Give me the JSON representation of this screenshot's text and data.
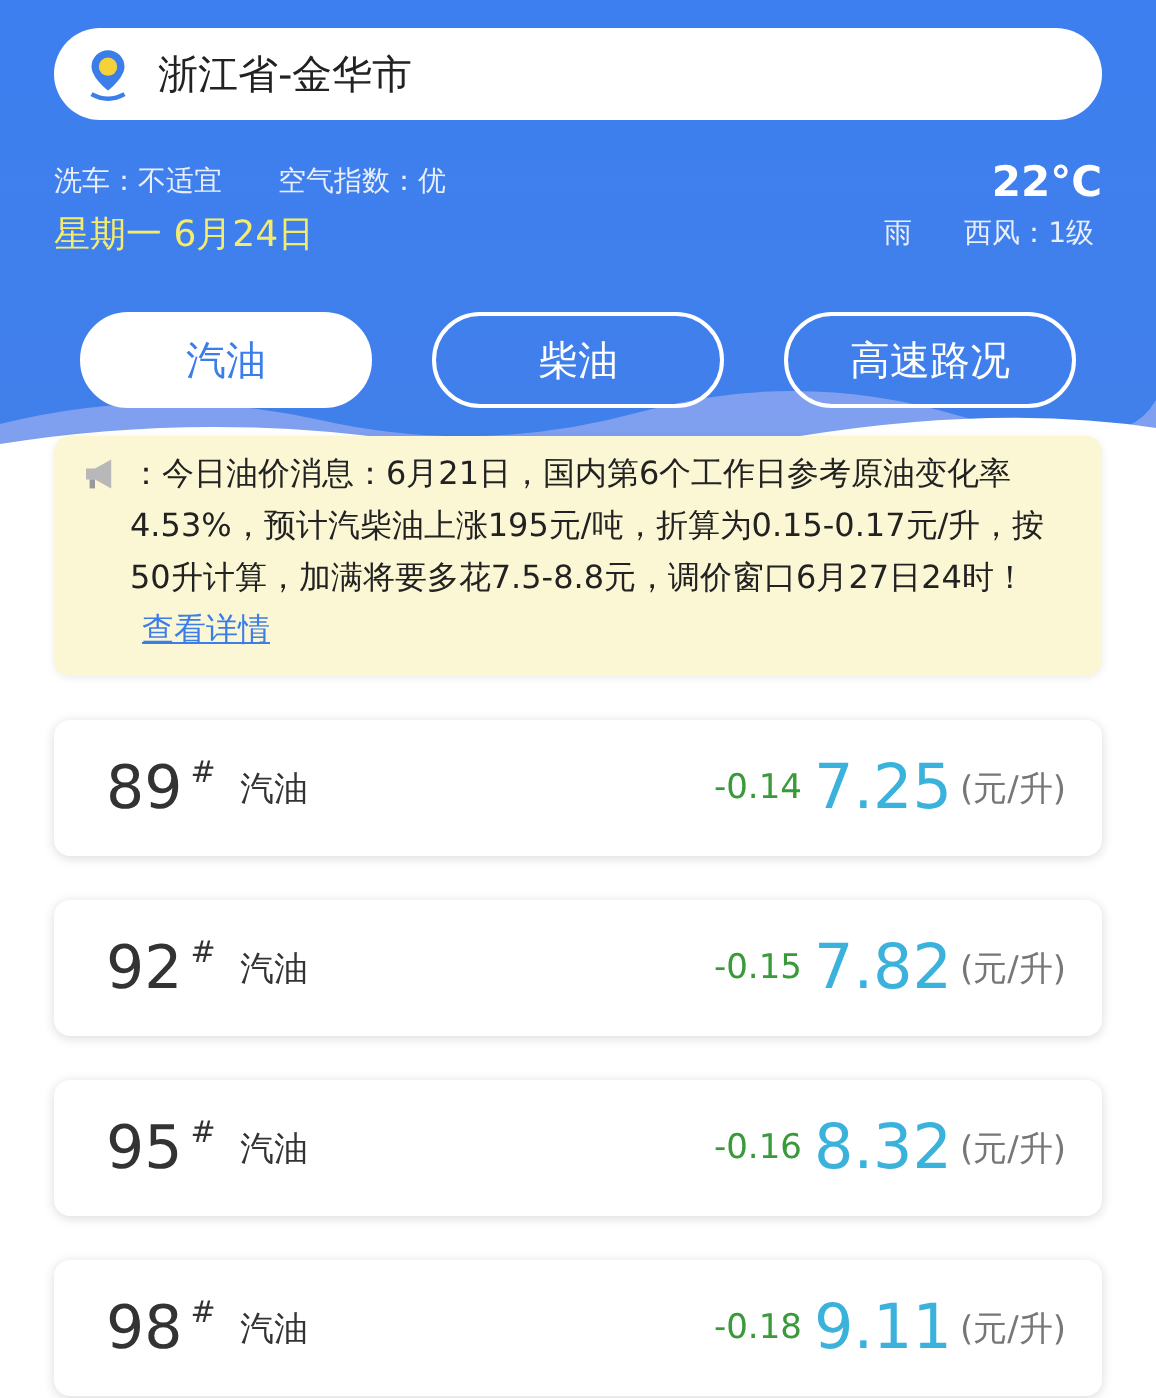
{
  "location": {
    "text": "浙江省-金华市"
  },
  "weather": {
    "car_wash": "洗车：不适宜",
    "air_index": "空气指数：优",
    "temperature": "22°C",
    "date": "星期一 6月24日",
    "condition": "雨",
    "wind": "西风：1级"
  },
  "tabs": [
    {
      "label": "汽油",
      "selected": true
    },
    {
      "label": "柴油",
      "selected": false
    },
    {
      "label": "高速路况",
      "selected": false
    }
  ],
  "notice": {
    "text": "：今日油价消息：6月21日，国内第6个工作日参考原油变化率4.53%，预计汽柴油上涨195元/吨，折算为0.15-0.17元/升，按50升计算，加满将要多花7.5-8.8元，调价窗口6月27日24时！",
    "link": "查看详情"
  },
  "prices": [
    {
      "grade": "89",
      "mark": "#",
      "name": "汽油",
      "change": "-0.14",
      "price": "7.25",
      "unit": "(元/升)"
    },
    {
      "grade": "92",
      "mark": "#",
      "name": "汽油",
      "change": "-0.15",
      "price": "7.82",
      "unit": "(元/升)"
    },
    {
      "grade": "95",
      "mark": "#",
      "name": "汽油",
      "change": "-0.16",
      "price": "8.32",
      "unit": "(元/升)"
    },
    {
      "grade": "98",
      "mark": "#",
      "name": "汽油",
      "change": "-0.18",
      "price": "9.11",
      "unit": "(元/升)"
    }
  ]
}
